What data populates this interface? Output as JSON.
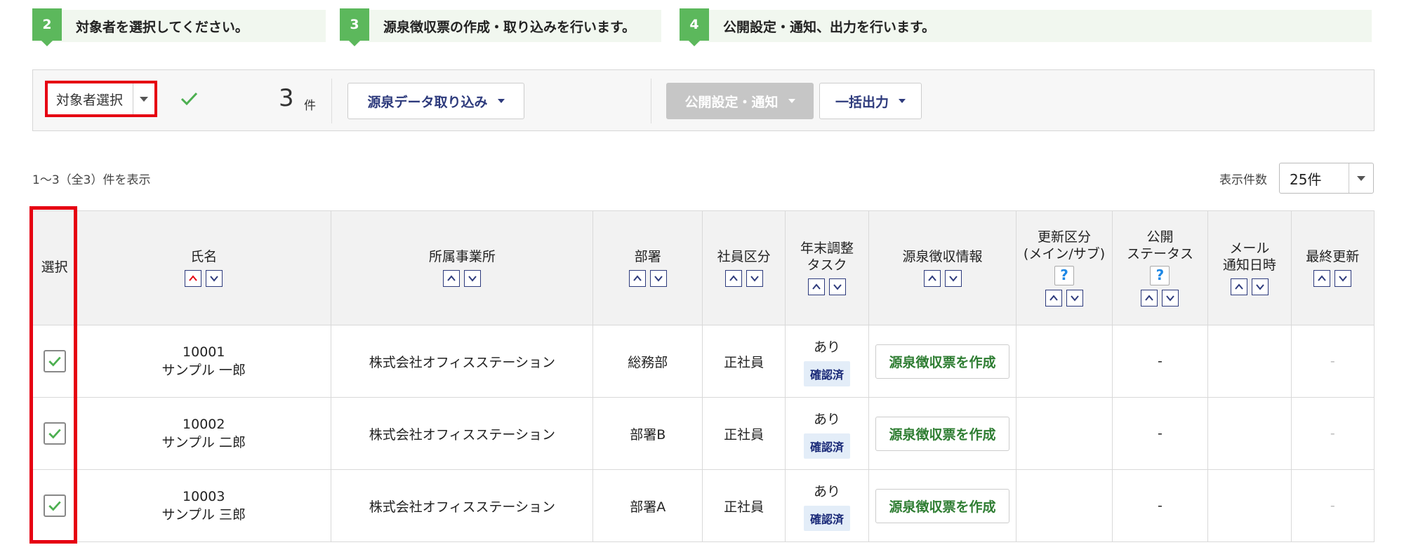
{
  "steps": [
    {
      "num": "2",
      "text": "対象者を選択してください。"
    },
    {
      "num": "3",
      "text": "源泉徴収票の作成・取り込みを行います。"
    },
    {
      "num": "4",
      "text": "公開設定・通知、出力を行います。"
    }
  ],
  "toolbar": {
    "target_select_label": "対象者選択",
    "count": "3",
    "count_unit": "件",
    "import_button": "源泉データ取り込み",
    "publish_button": "公開設定・通知",
    "export_button": "一括出力"
  },
  "listing": {
    "range_text": "1～3（全3）件を表示",
    "per_page_label": "表示件数",
    "per_page_value": "25件"
  },
  "table": {
    "headers": {
      "select": "選択",
      "name": "氏名",
      "office": "所属事業所",
      "dept": "部署",
      "emp_type": "社員区分",
      "year_end_1": "年末調整",
      "year_end_2": "タスク",
      "withholding": "源泉徴収情報",
      "update_1": "更新区分",
      "update_2": "(メイン/サブ)",
      "public_1": "公開",
      "public_2": "ステータス",
      "mail_1": "メール",
      "mail_2": "通知日時",
      "last_update": "最終更新",
      "help_mark": "?"
    },
    "rows": [
      {
        "id": "10001",
        "name": "サンプル 一郎",
        "office": "株式会社オフィスステーション",
        "dept": "総務部",
        "emp_type": "正社員",
        "task": "あり",
        "task_status": "確認済",
        "action": "源泉徴収票を作成",
        "public_status": "-",
        "last_update": "-"
      },
      {
        "id": "10002",
        "name": "サンプル 二郎",
        "office": "株式会社オフィスステーション",
        "dept": "部署B",
        "emp_type": "正社員",
        "task": "あり",
        "task_status": "確認済",
        "action": "源泉徴収票を作成",
        "public_status": "-",
        "last_update": "-"
      },
      {
        "id": "10003",
        "name": "サンプル 三郎",
        "office": "株式会社オフィスステーション",
        "dept": "部署A",
        "emp_type": "正社員",
        "task": "あり",
        "task_status": "確認済",
        "action": "源泉徴収票を作成",
        "public_status": "-",
        "last_update": "-"
      }
    ]
  },
  "colors": {
    "step_green": "#5cb85c",
    "highlight_red": "#e60012",
    "button_text_navy": "#2d3a7c",
    "action_green": "#2e7d32"
  }
}
